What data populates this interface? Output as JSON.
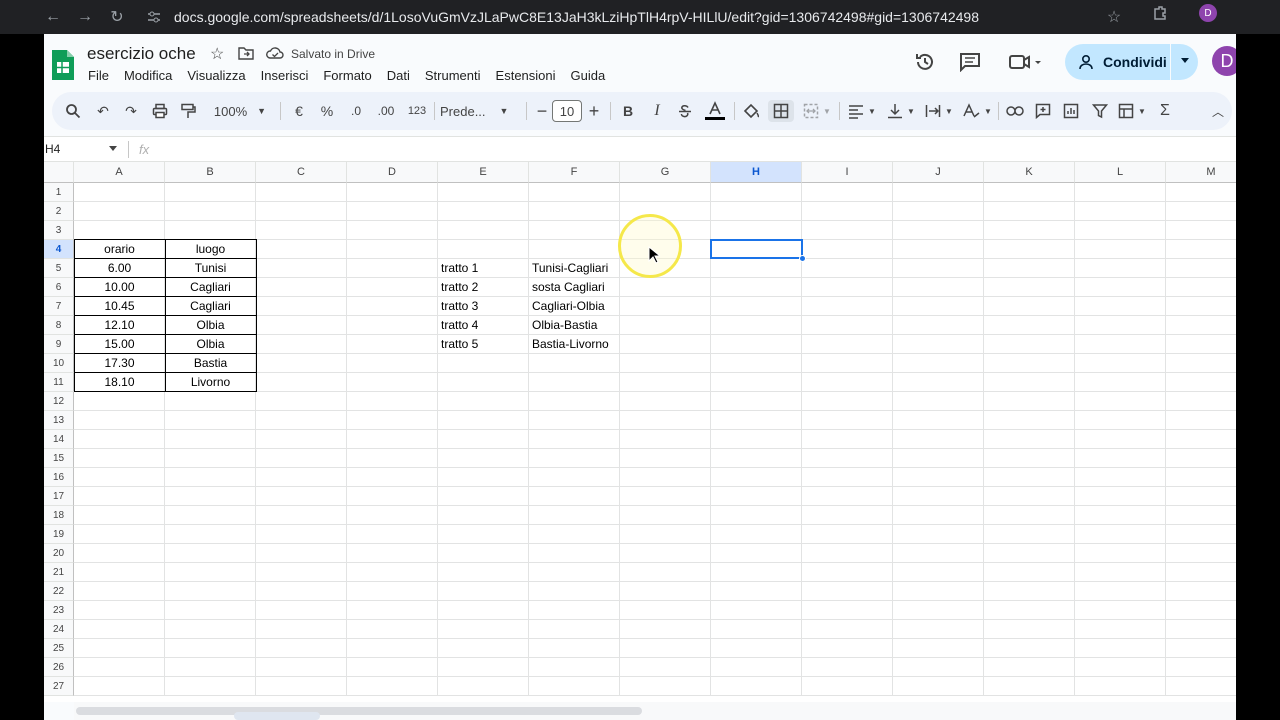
{
  "browser": {
    "url": "docs.google.com/spreadsheets/d/1LosoVuGmVzJLaPwC8E13JaH3kLziHpTlH4rpV-HILlU/edit?gid=1306742498#gid=1306742498",
    "profile_initial": "D"
  },
  "app": {
    "title": "esercizio oche",
    "saved_status": "Salvato in Drive",
    "menu": [
      "File",
      "Modifica",
      "Visualizza",
      "Inserisci",
      "Formato",
      "Dati",
      "Strumenti",
      "Estensioni",
      "Guida"
    ],
    "share_label": "Condividi",
    "avatar_initial": "D"
  },
  "toolbar": {
    "zoom": "100%",
    "currency": "€",
    "percent": "%",
    "dec_less": ".0",
    "dec_more": ".00",
    "number_format": "123",
    "font": "Prede...",
    "font_size": "10",
    "bold": "B",
    "italic": "I",
    "sum": "Σ"
  },
  "formula_bar": {
    "name_box": "H4",
    "fx": "fx"
  },
  "columns": [
    "A",
    "B",
    "C",
    "D",
    "E",
    "F",
    "G",
    "H",
    "I",
    "J",
    "K",
    "L",
    "M"
  ],
  "rows": [
    "1",
    "2",
    "3",
    "4",
    "5",
    "6",
    "7",
    "8",
    "9",
    "10",
    "11",
    "12",
    "13",
    "14",
    "15",
    "16",
    "17",
    "18",
    "19",
    "20",
    "21",
    "22",
    "23",
    "24",
    "25",
    "26",
    "27"
  ],
  "selected_cell": "H4",
  "table_main": {
    "headers": [
      "orario",
      "luogo"
    ],
    "rows": [
      [
        "6.00",
        "Tunisi"
      ],
      [
        "10.00",
        "Cagliari"
      ],
      [
        "10.45",
        "Cagliari"
      ],
      [
        "12.10",
        "Olbia"
      ],
      [
        "15.00",
        "Olbia"
      ],
      [
        "17.30",
        "Bastia"
      ],
      [
        "18.10",
        "Livorno"
      ]
    ]
  },
  "table_tratti": [
    [
      "tratto 1",
      "Tunisi-Cagliari"
    ],
    [
      "tratto 2",
      "sosta Cagliari"
    ],
    [
      "tratto 3",
      "Cagliari-Olbia"
    ],
    [
      "tratto 4",
      "Olbia-Bastia"
    ],
    [
      "tratto 5",
      "Bastia-Livorno"
    ]
  ],
  "colors": {
    "accent": "#1a73e8",
    "share_bg": "#c2e7ff",
    "avatar": "#8e44ad",
    "sheets_green": "#0f9d58"
  }
}
